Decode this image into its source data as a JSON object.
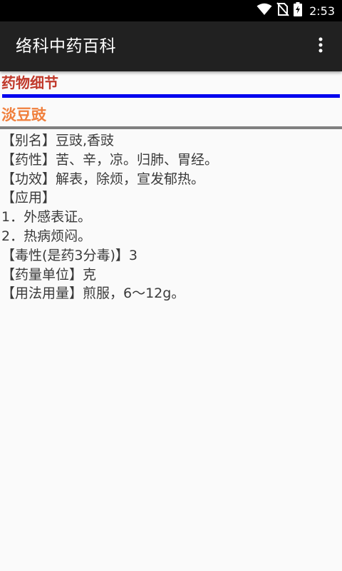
{
  "status_bar": {
    "time": "2:53",
    "icons": [
      "wifi-icon",
      "no-sim-icon",
      "battery-charging-icon"
    ]
  },
  "app_bar": {
    "title": "络科中药百科",
    "overflow_icon": "more-vert-icon"
  },
  "page": {
    "section_title": "药物细节",
    "herb_name": "淡豆豉",
    "details": [
      "【别名】豆豉,香豉",
      "【药性】苦、辛，凉。归肺、胃经。",
      "【功效】解表，除烦，宣发郁热。",
      "【应用】",
      "1．外感表证。",
      "2．热病烦闷。",
      "【毒性(是药3分毒)】3",
      "【药量单位】克",
      "【用法用量】煎服，6～12g。"
    ]
  },
  "colors": {
    "section_title": "#c0392b",
    "blue_rule": "#0000ee",
    "herb_name": "#f07f3c",
    "gray_rule": "#808080",
    "app_bar": "#212121",
    "status_bar": "#000000",
    "background": "#fafafa"
  }
}
